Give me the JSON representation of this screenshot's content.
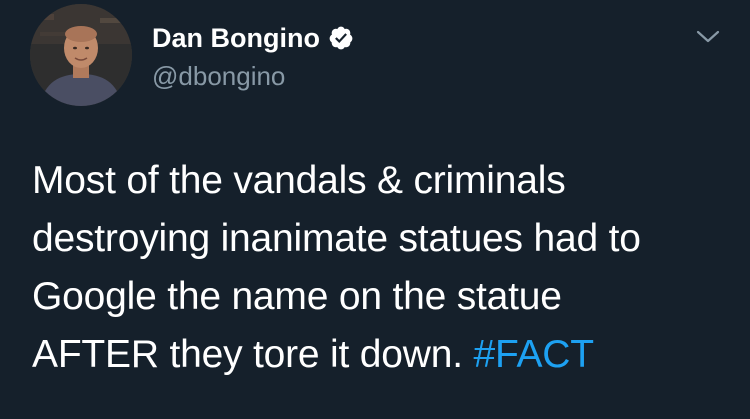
{
  "author": {
    "display_name": "Dan Bongino",
    "handle": "@dbongino",
    "verified": true
  },
  "tweet": {
    "lines": [
      "Most of the vandals & criminals",
      "destroying inanimate statues had to",
      "Google the name on the statue",
      "AFTER they tore it down. "
    ],
    "hashtag": "#FACT"
  },
  "colors": {
    "background": "#15202b",
    "text": "#ffffff",
    "secondary_text": "#8899a6",
    "link": "#1da1f2"
  },
  "icons": {
    "verified": "verified-badge-icon",
    "menu": "chevron-down-icon"
  }
}
